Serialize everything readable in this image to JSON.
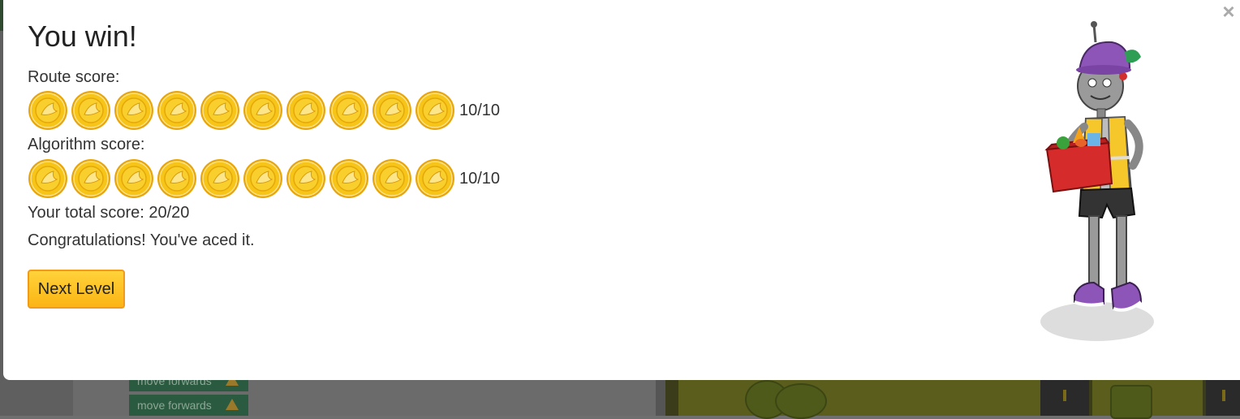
{
  "modal": {
    "title": "You win!",
    "close_icon": "×",
    "route_label": "Route score:",
    "route_score": "10/10",
    "route_coins": 10,
    "algorithm_label": "Algorithm score:",
    "algorithm_score": "10/10",
    "algorithm_coins": 10,
    "total_score": "Your total score: 20/20",
    "message": "Congratulations! You've aced it.",
    "next_button": "Next Level"
  },
  "background": {
    "blocks": [
      {
        "label": "move forwards",
        "icon": "arrow-up-icon"
      },
      {
        "label": "move forwards",
        "icon": "arrow-up-icon"
      }
    ]
  },
  "colors": {
    "coin": "#f7c418",
    "button": "#fbb514",
    "button_border": "#f29a1a"
  }
}
